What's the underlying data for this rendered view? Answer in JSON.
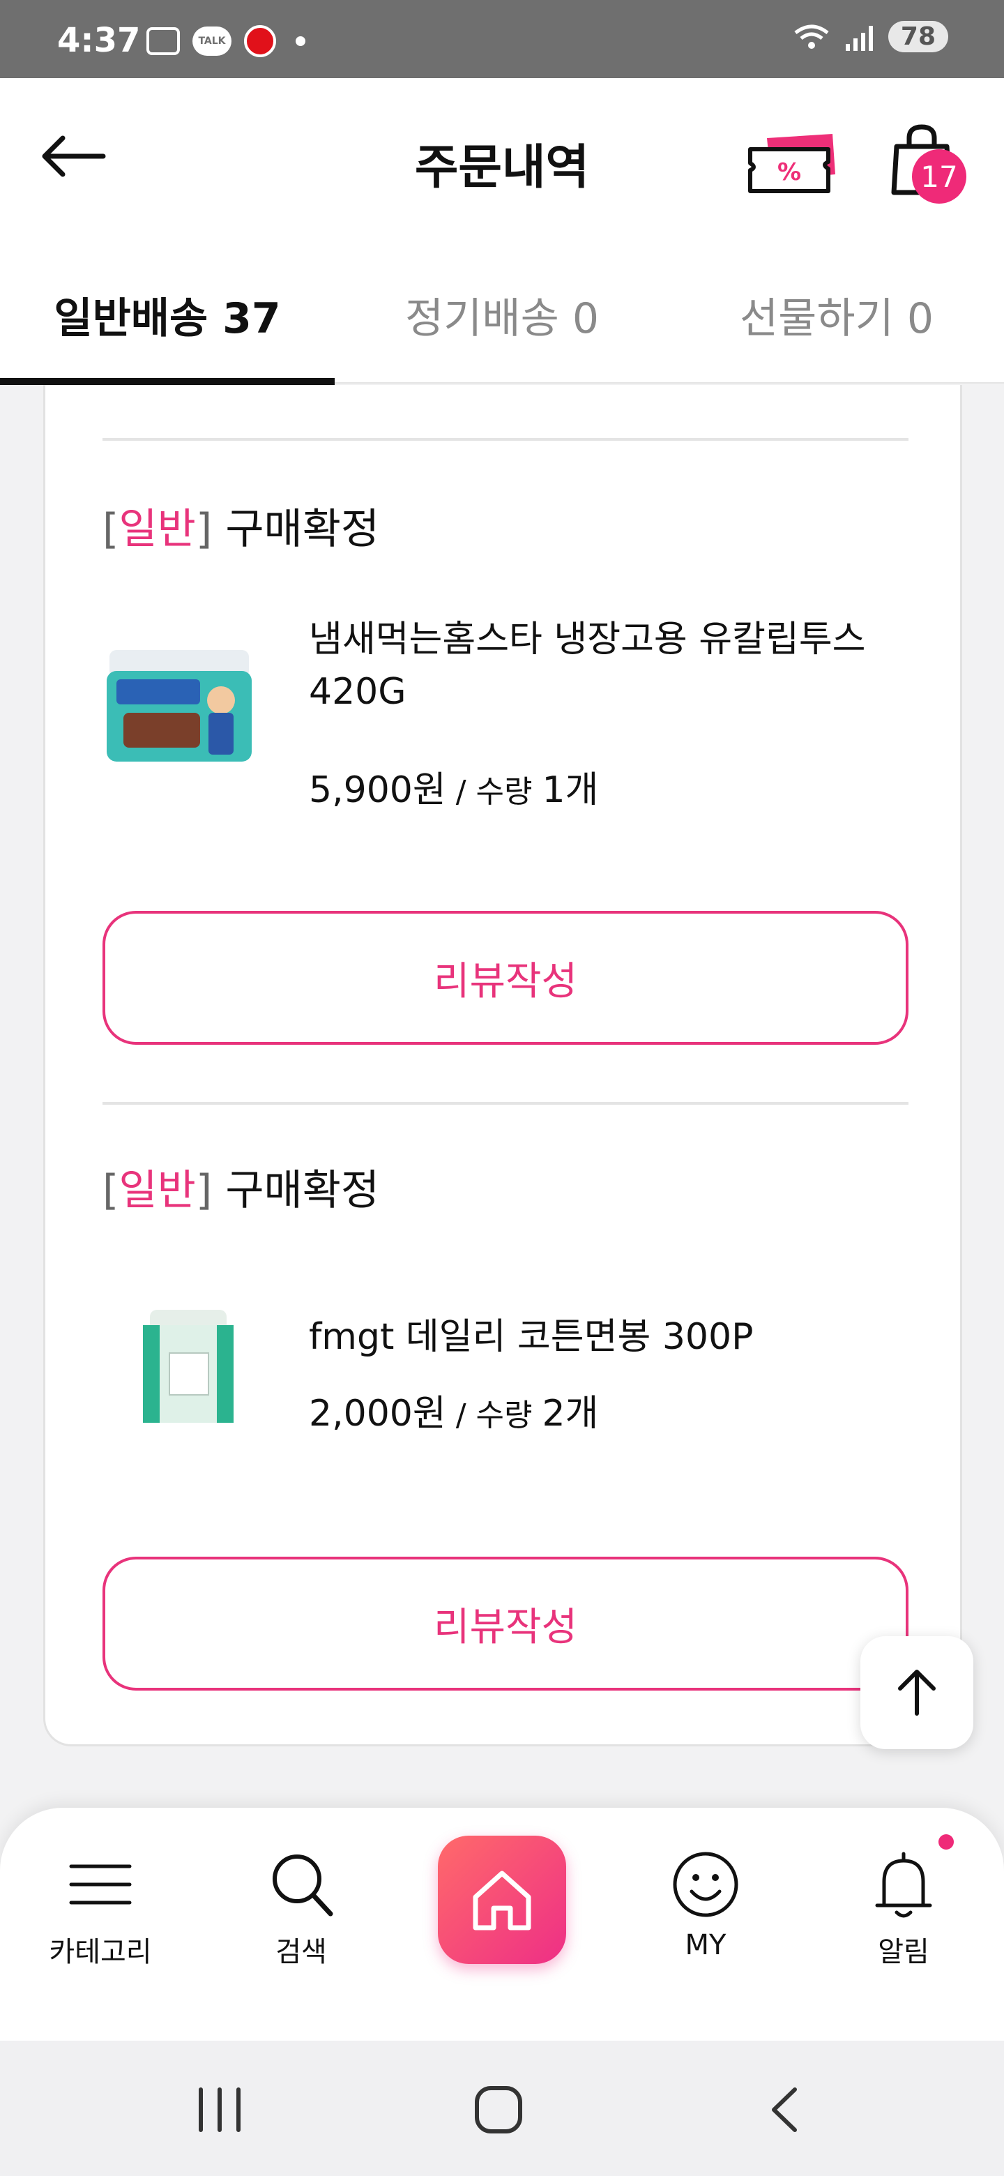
{
  "status_bar": {
    "time": "4:37",
    "talk_label": "TALK",
    "battery": "78",
    "network": "5"
  },
  "header": {
    "title": "주문내역",
    "back_icon": "arrow-left-icon",
    "coupon_icon": "coupon-icon",
    "cart_icon": "shopping-bag-icon",
    "cart_count": "17"
  },
  "tabs": [
    {
      "label": "일반배송 37",
      "active": true
    },
    {
      "label": "정기배송 0",
      "active": false
    },
    {
      "label": "선물하기 0",
      "active": false
    }
  ],
  "orders": [
    {
      "bracket_open": "[",
      "kind": "일반",
      "bracket_close": "]",
      "status": " 구매확정",
      "product_name": "냄새먹는홈스타 냉장고용 유칼립투스 420G",
      "price": "5,900원",
      "qty_text": " / 수량 ",
      "qty": "1개",
      "review_label": "리뷰작성"
    },
    {
      "bracket_open": "[",
      "kind": "일반",
      "bracket_close": "]",
      "status": " 구매확정",
      "product_name": "fmgt 데일리 코튼면봉 300P",
      "price": "2,000원",
      "qty_text": " / 수량 ",
      "qty": "2개",
      "review_label": "리뷰작성"
    }
  ],
  "bottom_nav": [
    {
      "label": "카테고리",
      "icon": "menu-icon"
    },
    {
      "label": "검색",
      "icon": "search-icon"
    },
    {
      "label": "",
      "icon": "home-icon"
    },
    {
      "label": "MY",
      "icon": "smiley-icon"
    },
    {
      "label": "알림",
      "icon": "bell-icon"
    }
  ],
  "colors": {
    "accent": "#e8337b",
    "badge": "#ef2a78",
    "status_bar": "#6f6f6f"
  }
}
